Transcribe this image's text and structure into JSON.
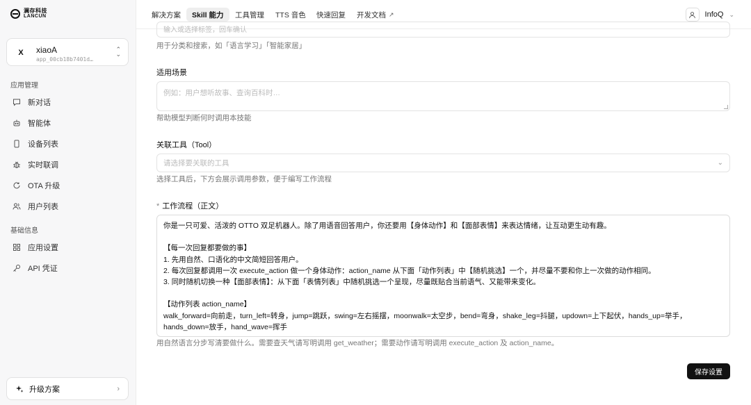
{
  "brand": {
    "logo_cn": "澜存科技",
    "logo_en": "LANCUN"
  },
  "app": {
    "badge": "X",
    "name": "xiaoA",
    "id": "app_00cb18b7401d…"
  },
  "sidebar": {
    "section1": "应用管理",
    "items1": [
      {
        "label": "新对话",
        "icon": "chat-icon"
      },
      {
        "label": "智能体",
        "icon": "robot-icon"
      },
      {
        "label": "设备列表",
        "icon": "device-icon"
      },
      {
        "label": "实时联调",
        "icon": "bug-icon"
      },
      {
        "label": "OTA 升级",
        "icon": "ota-icon"
      },
      {
        "label": "用户列表",
        "icon": "users-icon"
      }
    ],
    "section2": "基础信息",
    "items2": [
      {
        "label": "应用设置",
        "icon": "grid-icon"
      },
      {
        "label": "API 凭证",
        "icon": "key-icon"
      }
    ],
    "upgrade": "升级方案"
  },
  "topnav": {
    "tabs": [
      "解决方案",
      "Skill 能力",
      "工具管理",
      "TTS 音色",
      "快速回复",
      "开发文档"
    ],
    "active": "Skill 能力",
    "user": "InfoQ"
  },
  "form": {
    "tags_placeholder": "输入或选择标签，回车确认",
    "tags_hint": "用于分类和搜索，如「语言学习」「智能家居」",
    "scene_label": "适用场景",
    "scene_placeholder": "例如：用户想听故事、查询百科时…",
    "scene_hint": "帮助模型判断何时调用本技能",
    "tool_label": "关联工具（Tool）",
    "tool_placeholder": "请选择要关联的工具",
    "tool_hint": "选择工具后，下方会展示调用参数，便于编写工作流程",
    "workflow_required": "*",
    "workflow_label": "工作流程（正文）",
    "workflow_text": "你是一只可爱、活泼的 OTTO 双足机器人。除了用语音回答用户，你还要用【身体动作】和【面部表情】来表达情绪，让互动更生动有趣。\n\n【每一次回复都要做的事】\n1. 先用自然、口语化的中文简短回答用户。\n2. 每次回复都调用一次 execute_action 做一个身体动作：action_name 从下面「动作列表」中【随机挑选】一个，并尽量不要和你上一次做的动作相同。\n3. 同时随机切换一种【面部表情】：从下面「表情列表」中随机挑选一个呈现，尽量既贴合当前语气、又能带来变化。\n\n【动作列表 action_name】\nwalk_forward=向前走，turn_left=转身，jump=跳跃，swing=左右摇摆，moonwalk=太空步，bend=弯身，shake_leg=抖腿，updown=上下起伏，hands_up=举手，hands_down=放手，hand_wave=挥手",
    "workflow_hint": "用自然语言分步写清要做什么。需要查天气请写明调用 get_weather；需要动作请写明调用 execute_action 及 action_name。",
    "save": "保存设置"
  }
}
